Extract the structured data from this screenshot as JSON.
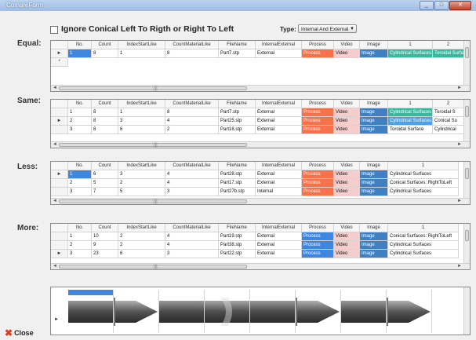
{
  "window": {
    "title": "ComareForm"
  },
  "options": {
    "ignore_label": "Ignore Conical Left To Rigth or Right To Left",
    "type_label": "Type:",
    "type_value": "Internal And External"
  },
  "columns": [
    "No.",
    "Count",
    "IndexStartLike",
    "CountMaterialLike",
    "FileName",
    "InternalExternal",
    "Process",
    "Video",
    "Image",
    "1",
    "2"
  ],
  "sections": {
    "equal": {
      "label": "Equal:",
      "rows": [
        [
          "1",
          "8",
          "1",
          "8",
          "Part7.stp",
          "External",
          "Process",
          "Video",
          "Image",
          "Cylindrical Surfaces",
          "Toroidal Surfa"
        ]
      ]
    },
    "same": {
      "label": "Same:",
      "rows": [
        [
          "1",
          "8",
          "1",
          "8",
          "Part7.stp",
          "External",
          "Process",
          "Video",
          "Image",
          "Cylindrical Surfaces",
          "Toroidal S"
        ],
        [
          "2",
          "8",
          "3",
          "4",
          "Part25.stp",
          "External",
          "Process",
          "Video",
          "Image",
          "Cylindrical Surfaces",
          "Conical Su"
        ],
        [
          "3",
          "8",
          "6",
          "2",
          "Part16.stp",
          "External",
          "Process",
          "Video",
          "Image",
          "Toroidal Surface",
          "Cylindrical"
        ]
      ]
    },
    "less": {
      "label": "Less:",
      "rows": [
        [
          "1",
          "6",
          "3",
          "4",
          "Part28.stp",
          "External",
          "Process",
          "Video",
          "Image",
          "Cylindrical Surfaces"
        ],
        [
          "2",
          "5",
          "2",
          "4",
          "Part17.stp",
          "External",
          "Process",
          "Video",
          "Image",
          "Conical Surfaces: RightToLeft"
        ],
        [
          "3",
          "7",
          "5",
          "3",
          "Part27b.stp",
          "Internal",
          "Process",
          "Video",
          "Image",
          "Cylindrical Surfaces"
        ]
      ]
    },
    "more": {
      "label": "More:",
      "rows": [
        [
          "1",
          "10",
          "2",
          "4",
          "Part19.stp",
          "External",
          "Process",
          "Video",
          "Image",
          "Conical Surfaces: RightToLeft"
        ],
        [
          "2",
          "9",
          "2",
          "4",
          "Part38.stp",
          "External",
          "Process",
          "Video",
          "Image",
          "Cylindrical Surfaces"
        ],
        [
          "3",
          "23",
          "6",
          "3",
          "Part22.stp",
          "External",
          "Process",
          "Video",
          "Image",
          "Cylindrical Surfaces"
        ]
      ]
    }
  },
  "shapes": [
    "cylinder",
    "cone-right",
    "cylinder",
    "rounded-cylinder",
    "cylinder",
    "cone-right",
    "cylinder",
    "cone-right"
  ],
  "colors": {
    "process_orange": "#f7714b",
    "process_blue": "#3f86e0",
    "image_blue": "#3f7fc2",
    "video_pink": "#f5cdcd",
    "surface_teal": "#38b99d",
    "surface_blue": "#4aa0e9"
  },
  "footer": {
    "close_label": "Close"
  }
}
